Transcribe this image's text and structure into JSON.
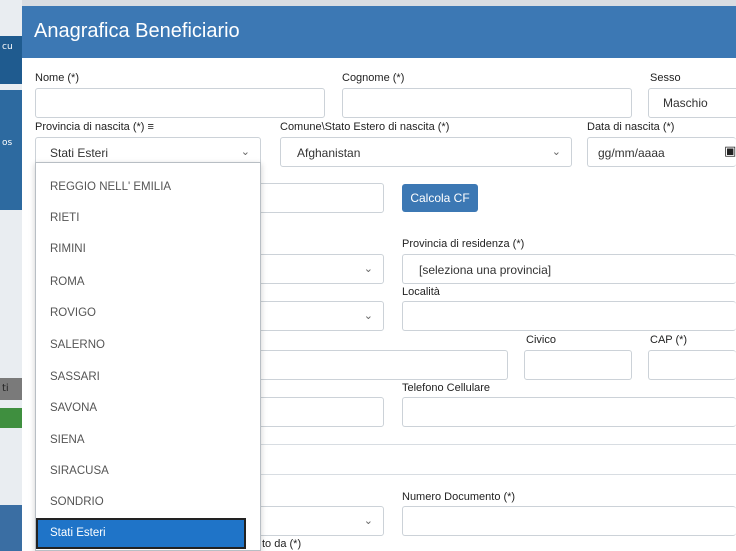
{
  "modal": {
    "title": "Anagrafica Beneficiario"
  },
  "fields": {
    "nome": {
      "label": "Nome (*)",
      "value": ""
    },
    "cognome": {
      "label": "Cognome (*)",
      "value": ""
    },
    "sesso": {
      "label": "Sesso",
      "value": "Maschio"
    },
    "provincia_nascita": {
      "label": "Provincia di nascita (*) ≡",
      "value": "Stati Esteri"
    },
    "comune_nascita": {
      "label": "Comune\\Stato Estero di nascita (*)",
      "value": "Afghanistan"
    },
    "data_nascita": {
      "label": "Data di nascita (*)",
      "placeholder": "gg/mm/aaaa"
    },
    "provincia_residenza": {
      "label": "Provincia di residenza (*)",
      "value": "[seleziona una provincia]"
    },
    "localita": {
      "label": "Località"
    },
    "civico": {
      "label": "Civico"
    },
    "cap": {
      "label": "CAP (*)"
    },
    "telefono": {
      "label": "Telefono Cellulare"
    },
    "numero_documento": {
      "label": "Numero Documento (*)"
    },
    "rilasciato_da": {
      "label": "to da (*)"
    }
  },
  "buttons": {
    "calcola_cf": "Calcola CF"
  },
  "dropdown": {
    "items": [
      "REGGIO NELL' EMILIA",
      "RIETI",
      "RIMINI",
      "ROMA",
      "ROVIGO",
      "SALERNO",
      "SASSARI",
      "SAVONA",
      "SIENA",
      "SIRACUSA",
      "SONDRIO",
      "Stati Esteri"
    ],
    "selected": "Stati Esteri"
  },
  "background": {
    "left_text_1": "cu",
    "left_text_2": "os",
    "left_text_3": "ti"
  },
  "colors": {
    "header": "#3c78b4",
    "selected_item": "#1f74c8",
    "button": "#3c78b4"
  },
  "icons": [
    "chevron-down-icon",
    "calendar-icon",
    "hamburger-icon",
    "scroll-up-icon",
    "scroll-down-icon"
  ]
}
